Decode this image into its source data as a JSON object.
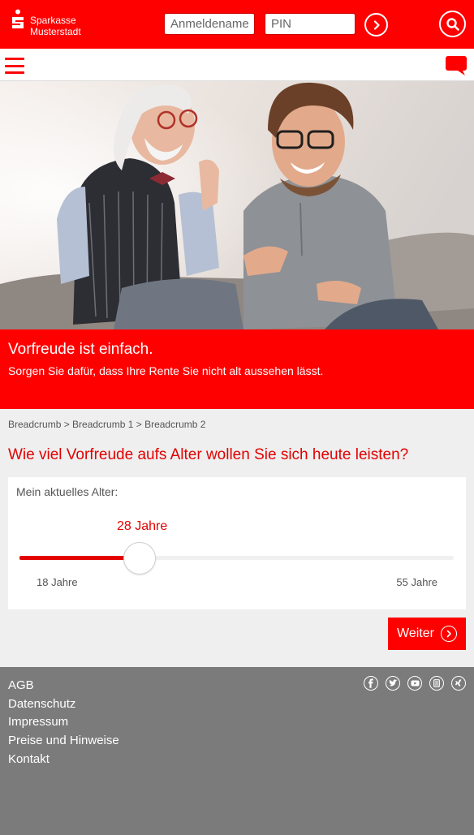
{
  "header": {
    "brand_line1": "Sparkasse",
    "brand_line2": "Musterstadt",
    "login": {
      "username_placeholder": "Anmeldename",
      "pin_placeholder": "PIN"
    }
  },
  "icons": {
    "logo": "sparkasse-s-icon",
    "login_submit": "chevron-right-circle-icon",
    "search": "search-icon",
    "menu": "hamburger-menu-icon",
    "chat": "chat-bubble-icon",
    "next": "chevron-right-circle-icon",
    "social": [
      "facebook-icon",
      "twitter-icon",
      "youtube-icon",
      "app-icon",
      "xing-icon"
    ]
  },
  "colors": {
    "brand_red": "#ff0000",
    "text_red": "#e30000",
    "footer_gray": "#7b7b7b",
    "page_bg": "#efefef"
  },
  "teaser": {
    "title": "Vorfreude ist einfach.",
    "subtitle": "Sorgen Sie dafür, dass Ihre Rente Sie nicht alt aussehen lässt."
  },
  "breadcrumb": "Breadcrumb > Breadcrumb 1 > Breadcrumb 2",
  "question": "Wie viel Vorfreude aufs Alter wollen Sie sich heute leisten?",
  "age_slider": {
    "label": "Mein aktuelles Alter:",
    "value_label": "28 Jahre",
    "value": 28,
    "min": 18,
    "max": 55,
    "min_label": "18 Jahre",
    "max_label": "55 Jahre"
  },
  "next_button": "Weiter",
  "footer": {
    "links": [
      "AGB",
      "Datenschutz",
      "Impressum",
      "Preise und Hinweise",
      "Kontakt"
    ]
  }
}
